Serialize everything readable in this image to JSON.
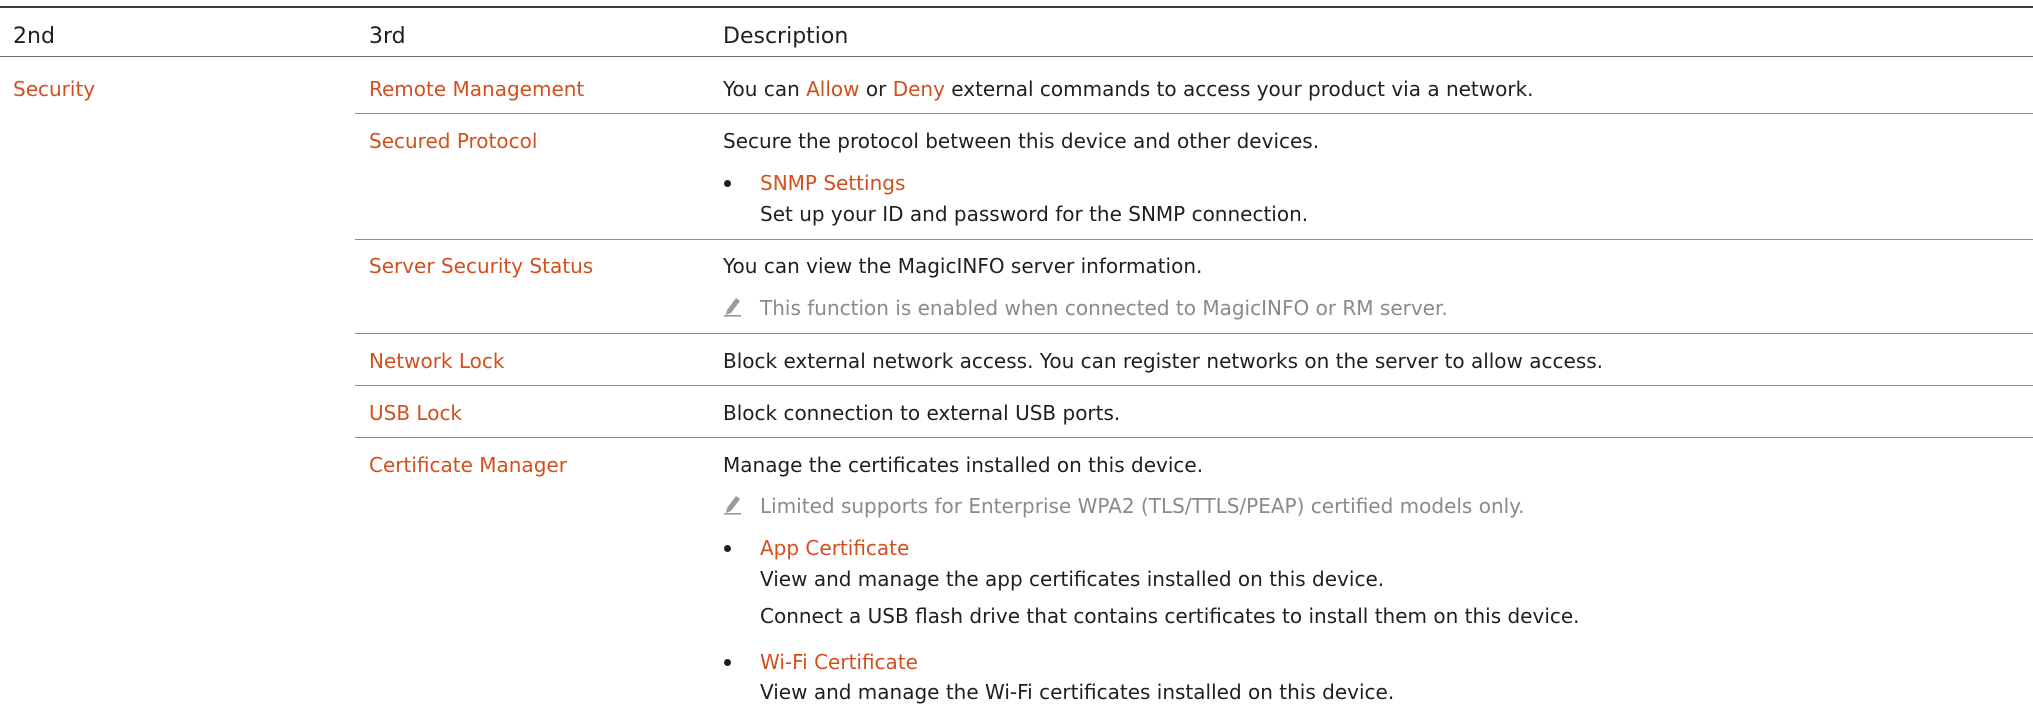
{
  "header": {
    "col_2nd": "2nd",
    "col_3rd": "3rd",
    "col_desc": "Description"
  },
  "category": "Security",
  "rows": [
    {
      "name": "Remote Management",
      "desc_pre": "You can ",
      "desc_opt1": "Allow",
      "desc_mid": " or ",
      "desc_opt2": "Deny",
      "desc_post": " external commands to access your product via a network."
    },
    {
      "name": "Secured Protocol",
      "desc": "Secure the protocol between this device and other devices.",
      "bullet_title": "SNMP Settings",
      "bullet_text": "Set up your ID and password for the SNMP connection."
    },
    {
      "name": "Server Security Status",
      "desc": "You can view the MagicINFO server information.",
      "note": "This function is enabled when connected to MagicINFO or RM server."
    },
    {
      "name": "Network Lock",
      "desc": "Block external network access. You can register networks on the server to allow access."
    },
    {
      "name": "USB Lock",
      "desc": "Block connection to external USB ports."
    },
    {
      "name": "Certificate Manager",
      "desc": "Manage the certificates installed on this device.",
      "note": "Limited supports for Enterprise WPA2 (TLS/TTLS/PEAP) certified models only.",
      "bullets": [
        {
          "title": "App Certificate",
          "line1": "View and manage the app certificates installed on this device.",
          "line2": "Connect a USB flash drive that contains certificates to install them on this device."
        },
        {
          "title": "Wi-Fi Certificate",
          "line1": "View and manage the Wi-Fi certificates installed on this device."
        }
      ]
    }
  ],
  "colors": {
    "accent": "#d2501e",
    "text": "#1f1f1f",
    "note": "#8a8a8a",
    "rule": "#8c8c8c"
  }
}
